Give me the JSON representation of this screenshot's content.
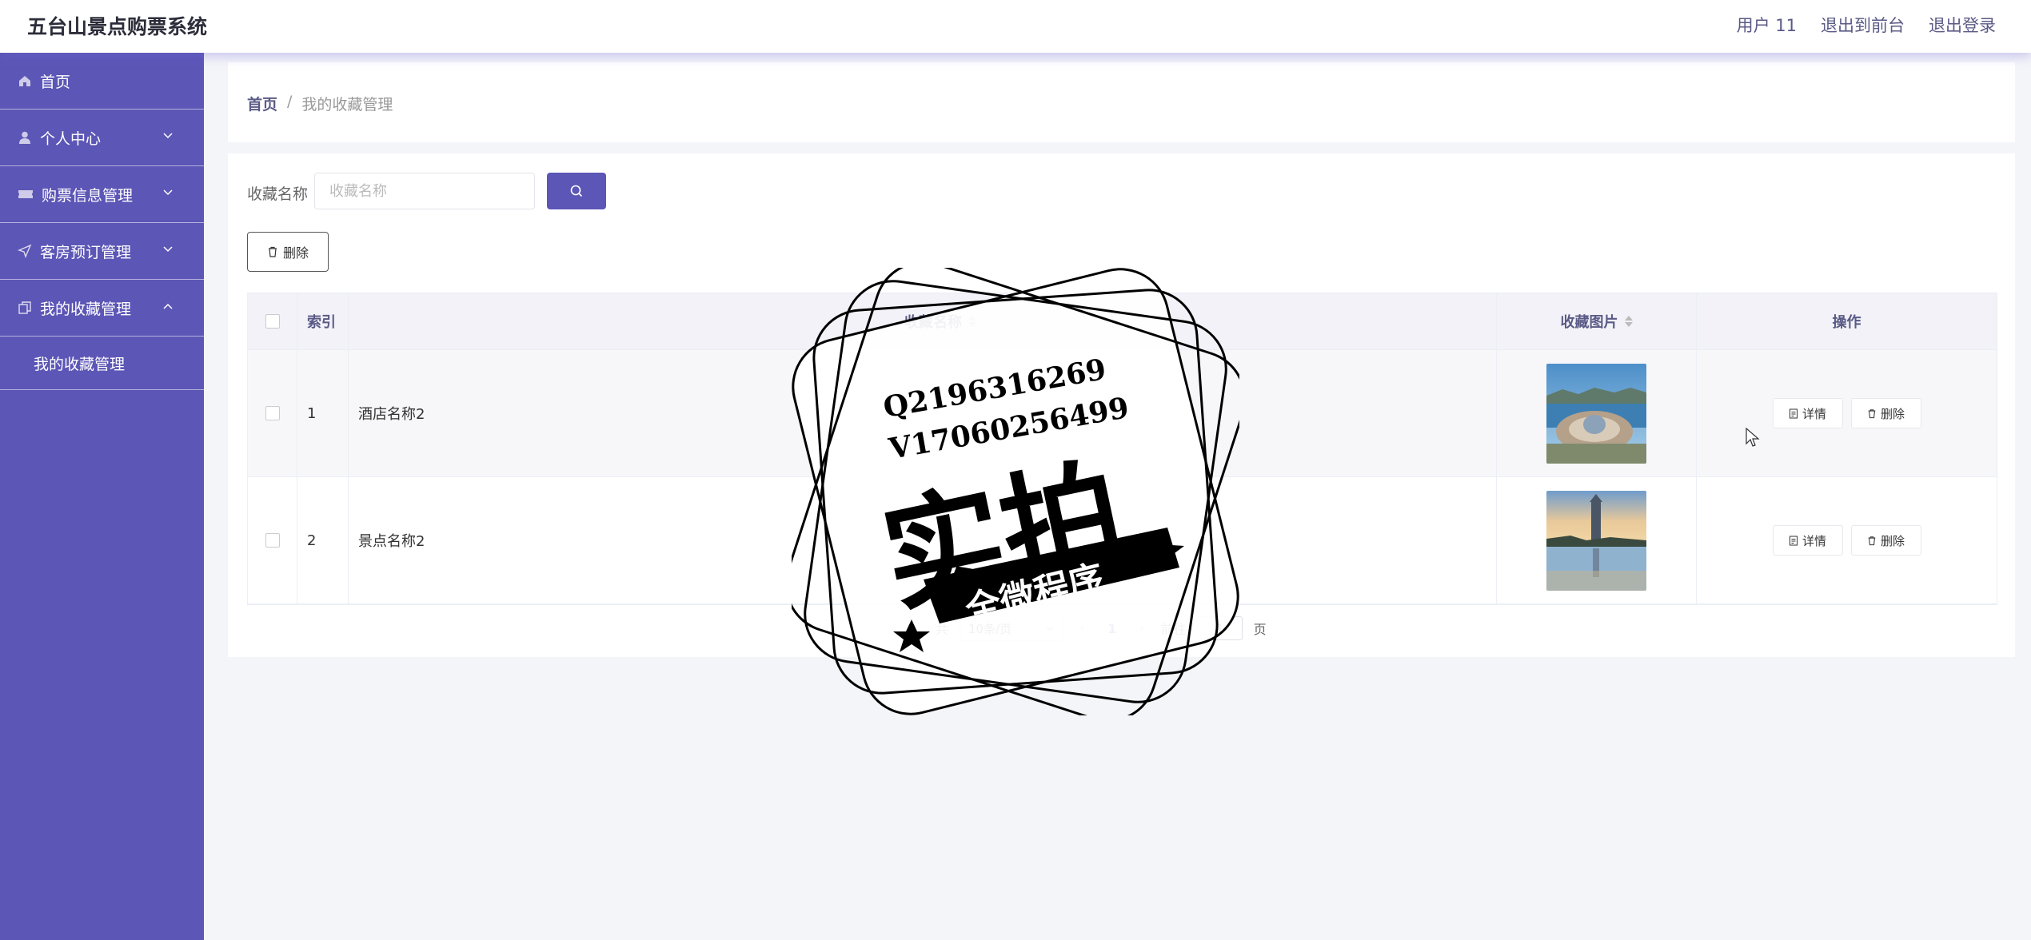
{
  "header": {
    "title": "五台山景点购票系统",
    "user": "用户 11",
    "to_front": "退出到前台",
    "logout": "退出登录"
  },
  "sidebar": {
    "items": [
      {
        "label": "首页",
        "icon": "home-icon"
      },
      {
        "label": "个人中心",
        "icon": "user-icon"
      },
      {
        "label": "购票信息管理",
        "icon": "ticket-icon"
      },
      {
        "label": "客房预订管理",
        "icon": "send-icon"
      },
      {
        "label": "我的收藏管理",
        "icon": "copy-icon"
      }
    ],
    "sub_items": [
      {
        "label": "我的收藏管理"
      }
    ]
  },
  "breadcrumb": {
    "home": "首页",
    "separator": "/",
    "current": "我的收藏管理"
  },
  "search": {
    "label": "收藏名称",
    "placeholder": "收藏名称"
  },
  "toolbar": {
    "delete_label": "删除"
  },
  "table": {
    "columns": {
      "index": "索引",
      "name": "收藏名称",
      "image": "收藏图片",
      "ops": "操作"
    },
    "rows": [
      {
        "index": "1",
        "name": "酒店名称2",
        "detail": "详情",
        "delete": "删除"
      },
      {
        "index": "2",
        "name": "景点名称2",
        "detail": "详情",
        "delete": "删除"
      }
    ]
  },
  "pagination": {
    "total_prefix": "共",
    "page_size": "10条/页",
    "current_page": "1",
    "goto_label": "前往",
    "goto_value": "1",
    "page_suffix": "页"
  },
  "watermark": {
    "line1": "Q2196316269",
    "line2": "V17060256499",
    "big": "实拍",
    "banner": "全微程序"
  },
  "colors": {
    "accent": "#5c56b6",
    "background": "#f4f5f9"
  }
}
